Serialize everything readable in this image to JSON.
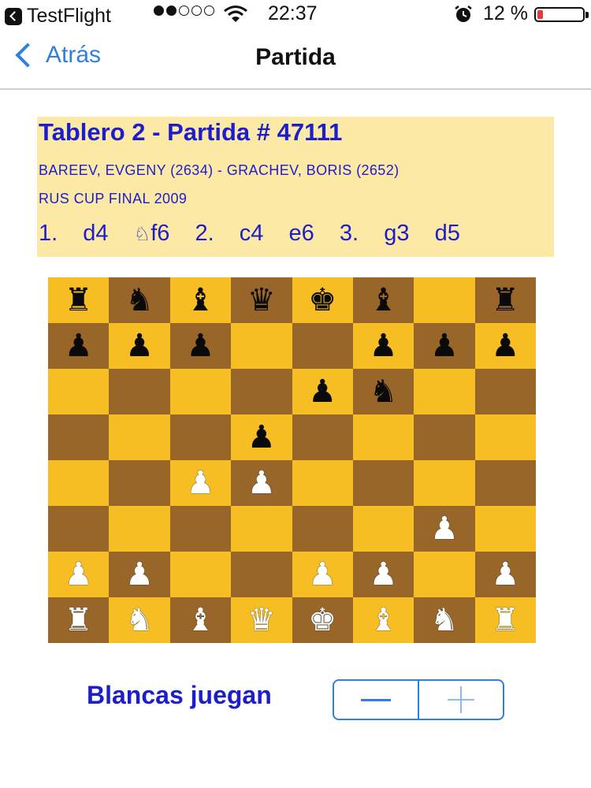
{
  "status_bar": {
    "back_app": "TestFlight",
    "signal_dots": [
      true,
      true,
      false,
      false,
      false
    ],
    "time": "22:37",
    "battery_percent": "12 %",
    "battery_level": 0.12,
    "icons": [
      "wifi-icon",
      "alarm-icon",
      "battery-icon"
    ]
  },
  "nav": {
    "back_label": "Atrás",
    "title": "Partida"
  },
  "game": {
    "title": "Tablero 2 - Partida # 47111",
    "players": "BAREEV, EVGENY (2634) - GRACHEV, BORIS (2652)",
    "event": "RUS CUP FINAL 2009",
    "moves_part1": "1.  d4  ",
    "moves_knight": "♘",
    "moves_part2": "f6  2.  c4  e6  3.  g3  d5"
  },
  "board": {
    "ranks": [
      [
        "r",
        "n",
        "b",
        "q",
        "k",
        "b",
        "",
        "r"
      ],
      [
        "p",
        "p",
        "p",
        "",
        "",
        "p",
        "p",
        "p"
      ],
      [
        "",
        "",
        "",
        "",
        "p",
        "n",
        "",
        ""
      ],
      [
        "",
        "",
        "",
        "p",
        "",
        "",
        "",
        ""
      ],
      [
        "",
        "",
        "P",
        "P",
        "",
        "",
        "",
        ""
      ],
      [
        "",
        "",
        "",
        "",
        "",
        "",
        "P",
        ""
      ],
      [
        "P",
        "P",
        "",
        "",
        "P",
        "P",
        "",
        "P"
      ],
      [
        "R",
        "N",
        "B",
        "Q",
        "K",
        "B",
        "N",
        "R"
      ]
    ],
    "colors": {
      "light": "#f6be22",
      "dark": "#986628"
    }
  },
  "footer": {
    "turn_label": "Blancas juegan",
    "stepper": {
      "minus": "minus-icon",
      "plus": "plus-icon"
    }
  },
  "colors": {
    "accent": "#2f7fe0",
    "text_blue": "#1c1ecc",
    "panel": "#fde9a6"
  }
}
